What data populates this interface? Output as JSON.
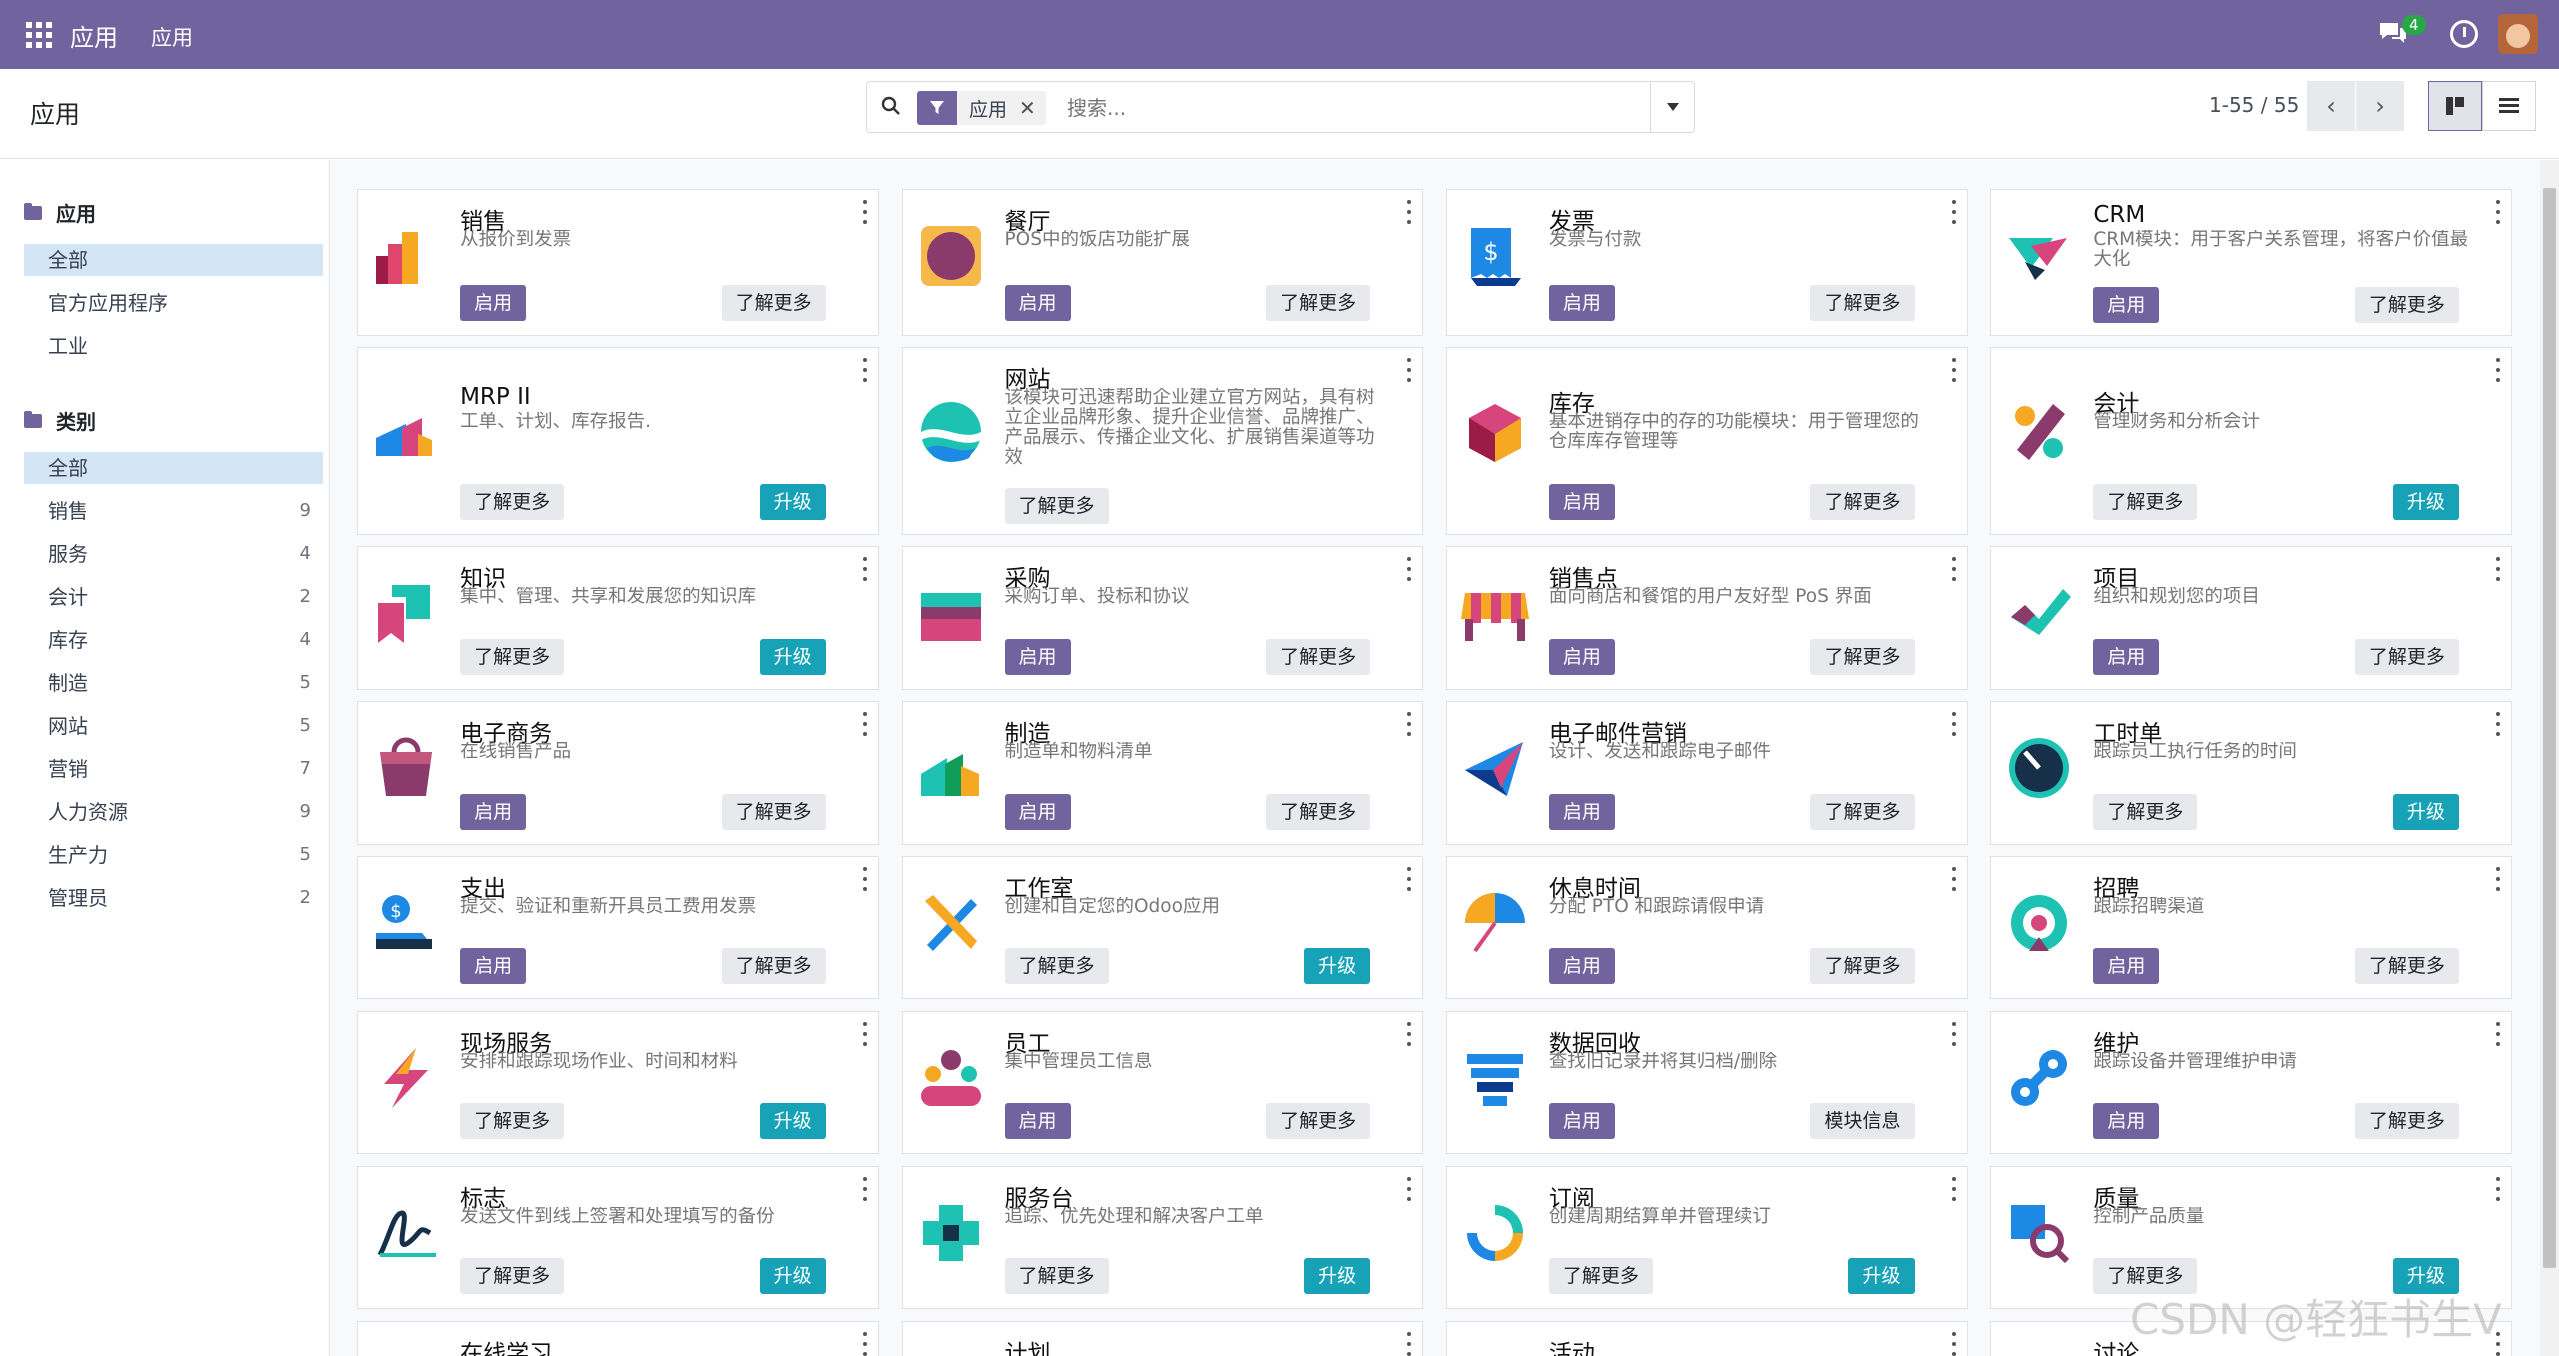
{
  "topbar": {
    "brand": "应用",
    "menu": "应用",
    "chat_count": "4"
  },
  "control": {
    "title": "应用",
    "facet": "应用",
    "search_placeholder": "搜索...",
    "pager": "1-55 / 55"
  },
  "sidebar": {
    "group1": {
      "title": "应用",
      "items": [
        "全部",
        "官方应用程序",
        "工业"
      ]
    },
    "group2": {
      "title": "类别",
      "items": [
        {
          "label": "全部",
          "count": ""
        },
        {
          "label": "销售",
          "count": "9"
        },
        {
          "label": "服务",
          "count": "4"
        },
        {
          "label": "会计",
          "count": "2"
        },
        {
          "label": "库存",
          "count": "4"
        },
        {
          "label": "制造",
          "count": "5"
        },
        {
          "label": "网站",
          "count": "5"
        },
        {
          "label": "营销",
          "count": "7"
        },
        {
          "label": "人力资源",
          "count": "9"
        },
        {
          "label": "生产力",
          "count": "5"
        },
        {
          "label": "管理员",
          "count": "2"
        }
      ]
    }
  },
  "apps": [
    {
      "name": "销售",
      "desc": "从报价到发票",
      "b1": "启用",
      "b2": "了解更多",
      "icon": "sales-icon"
    },
    {
      "name": "餐厅",
      "desc": "POS中的饭店功能扩展",
      "b1": "启用",
      "b2": "了解更多",
      "icon": "restaurant-icon"
    },
    {
      "name": "发票",
      "desc": "发票与付款",
      "b1": "启用",
      "b2": "了解更多",
      "icon": "invoice-icon"
    },
    {
      "name": "CRM",
      "desc": "CRM模块：用于客户关系管理，将客户价值最大化",
      "b1": "启用",
      "b2": "了解更多",
      "icon": "crm-icon"
    },
    {
      "name": "MRP II",
      "desc": "工单、计划、库存报告.",
      "b1": "了解更多",
      "b2": "升级",
      "icon": "mrp-icon"
    },
    {
      "name": "网站",
      "desc": "该模块可迅速帮助企业建立官方网站，具有树立企业品牌形象、提升企业信誉、品牌推广、产品展示、传播企业文化、扩展销售渠道等功效",
      "b1": "了解更多",
      "b2": "",
      "icon": "website-icon"
    },
    {
      "name": "库存",
      "desc": "基本进销存中的存的功能模块：用于管理您的仓库库存管理等",
      "b1": "启用",
      "b2": "了解更多",
      "icon": "inventory-icon"
    },
    {
      "name": "会计",
      "desc": "管理财务和分析会计",
      "b1": "了解更多",
      "b2": "升级",
      "icon": "accounting-icon"
    },
    {
      "name": "知识",
      "desc": "集中、管理、共享和发展您的知识库",
      "b1": "了解更多",
      "b2": "升级",
      "icon": "knowledge-icon"
    },
    {
      "name": "采购",
      "desc": "采购订单、投标和协议",
      "b1": "启用",
      "b2": "了解更多",
      "icon": "purchase-icon"
    },
    {
      "name": "销售点",
      "desc": "面向商店和餐馆的用户友好型 PoS 界面",
      "b1": "启用",
      "b2": "了解更多",
      "icon": "pos-icon"
    },
    {
      "name": "项目",
      "desc": "组织和规划您的项目",
      "b1": "启用",
      "b2": "了解更多",
      "icon": "project-icon"
    },
    {
      "name": "电子商务",
      "desc": "在线销售产品",
      "b1": "启用",
      "b2": "了解更多",
      "icon": "ecommerce-icon"
    },
    {
      "name": "制造",
      "desc": "制造单和物料清单",
      "b1": "启用",
      "b2": "了解更多",
      "icon": "manufacturing-icon"
    },
    {
      "name": "电子邮件营销",
      "desc": "设计、发送和跟踪电子邮件",
      "b1": "启用",
      "b2": "了解更多",
      "icon": "email-marketing-icon"
    },
    {
      "name": "工时单",
      "desc": "跟踪员工执行任务的时间",
      "b1": "了解更多",
      "b2": "升级",
      "icon": "timesheet-icon"
    },
    {
      "name": "支出",
      "desc": "提交、验证和重新开具员工费用发票",
      "b1": "启用",
      "b2": "了解更多",
      "icon": "expenses-icon"
    },
    {
      "name": "工作室",
      "desc": "创建和自定您的Odoo应用",
      "b1": "了解更多",
      "b2": "升级",
      "icon": "studio-icon"
    },
    {
      "name": "休息时间",
      "desc": "分配 PTO 和跟踪请假申请",
      "b1": "启用",
      "b2": "了解更多",
      "icon": "timeoff-icon"
    },
    {
      "name": "招聘",
      "desc": "跟踪招聘渠道",
      "b1": "启用",
      "b2": "了解更多",
      "icon": "recruitment-icon"
    },
    {
      "name": "现场服务",
      "desc": "安排和跟踪现场作业、时间和材料",
      "b1": "了解更多",
      "b2": "升级",
      "icon": "field-service-icon"
    },
    {
      "name": "员工",
      "desc": "集中管理员工信息",
      "b1": "启用",
      "b2": "了解更多",
      "icon": "employees-icon"
    },
    {
      "name": "数据回收",
      "desc": "查找旧记录并将其归档/删除",
      "b1": "启用",
      "b2": "模块信息",
      "icon": "data-recycle-icon"
    },
    {
      "name": "维护",
      "desc": "跟踪设备并管理维护申请",
      "b1": "启用",
      "b2": "了解更多",
      "icon": "maintenance-icon"
    },
    {
      "name": "标志",
      "desc": "发送文件到线上签署和处理填写的备份",
      "b1": "了解更多",
      "b2": "升级",
      "icon": "sign-icon"
    },
    {
      "name": "服务台",
      "desc": "追踪、优先处理和解决客户工单",
      "b1": "了解更多",
      "b2": "升级",
      "icon": "helpdesk-icon"
    },
    {
      "name": "订阅",
      "desc": "创建周期结算单并管理续订",
      "b1": "了解更多",
      "b2": "升级",
      "icon": "subscription-icon"
    },
    {
      "name": "质量",
      "desc": "控制产品质量",
      "b1": "了解更多",
      "b2": "升级",
      "icon": "quality-icon"
    },
    {
      "name": "在线学习",
      "desc": "",
      "b1": "",
      "b2": "",
      "icon": "elearning-icon"
    },
    {
      "name": "计划",
      "desc": "",
      "b1": "",
      "b2": "",
      "icon": "planning-icon"
    },
    {
      "name": "活动",
      "desc": "",
      "b1": "",
      "b2": "",
      "icon": "events-icon"
    },
    {
      "name": "讨论",
      "desc": "",
      "b1": "",
      "b2": "",
      "icon": "discuss-icon"
    }
  ],
  "watermark": "CSDN @轻狂书生V"
}
